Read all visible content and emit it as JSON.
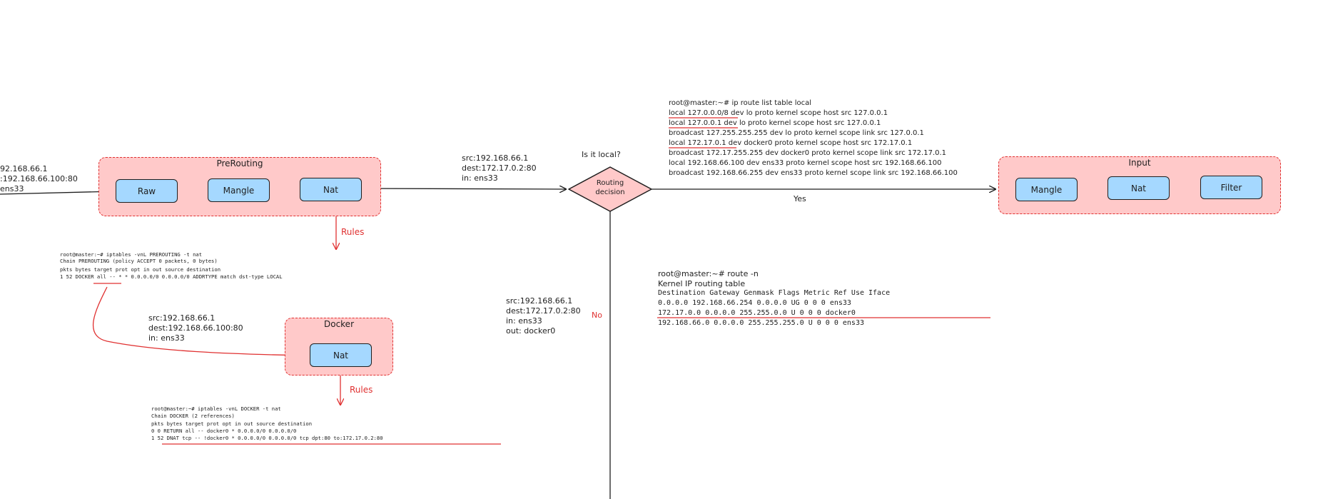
{
  "prerouting": {
    "title": "PreRouting",
    "raw": "Raw",
    "mangle": "Mangle",
    "nat": "Nat"
  },
  "input_packet": {
    "line1": "92.168.66.1",
    "line2": ":192.168.66.100:80",
    "line3": "ens33"
  },
  "rules_1": "Rules",
  "rules_2": "Rules",
  "prerouting_cmd": {
    "line1": "root@master:~# iptables -vnL PREROUTING -t nat",
    "line2": "Chain PREROUTING (policy ACCEPT 0 packets, 0 bytes)",
    "header": " pkts bytes target     prot opt in     out     source               destination",
    "row": "    1    52 DOCKER     all  --  *      *       0.0.0.0/0            0.0.0.0/0            ADDRTYPE match dst-type LOCAL"
  },
  "docker_packet": {
    "line1": "src:192.168.66.1",
    "line2": "dest:192.168.66.100:80",
    "line3": "in: ens33"
  },
  "docker": {
    "title": "Docker",
    "nat": "Nat"
  },
  "docker_cmd": {
    "line1": "root@master:~# iptables -vnL DOCKER -t nat",
    "line2": "Chain DOCKER (2 references)",
    "header": " pkts bytes target     prot opt in     out     source               destination",
    "row1": "    0     0 RETURN     all  --  docker0 *       0.0.0.0/0            0.0.0.0/0",
    "row2": "    1    52 DNAT       tcp  --  !docker0 *       0.0.0.0/0            0.0.0.0/0            tcp dpt:80 to:172.17.0.2:80"
  },
  "after_nat_packet": {
    "line1": "src:192.168.66.1",
    "line2": "dest:172.17.0.2:80",
    "line3": "in: ens33"
  },
  "decision": {
    "question": "Is it local?",
    "label": "Routing decision",
    "yes": "Yes",
    "no": "No"
  },
  "no_packet": {
    "line1": "src:192.168.66.1",
    "line2": "dest:172.17.0.2:80",
    "line3": "in: ens33",
    "line4": "out: docker0"
  },
  "ip_route": {
    "cmd": "root@master:~# ip route list table local",
    "lines": [
      "local 127.0.0.0/8 dev lo proto kernel scope host src 127.0.0.1",
      "local 127.0.0.1 dev lo proto kernel scope host src 127.0.0.1",
      "broadcast 127.255.255.255 dev lo proto kernel scope link src 127.0.0.1",
      "local 172.17.0.1 dev docker0 proto kernel scope host src 172.17.0.1",
      "broadcast 172.17.255.255 dev docker0 proto kernel scope link src 172.17.0.1",
      "local 192.168.66.100 dev ens33 proto kernel scope host src 192.168.66.100",
      "broadcast 192.168.66.255 dev ens33 proto kernel scope link src 192.168.66.100"
    ]
  },
  "route_n": {
    "cmd": "root@master:~# route -n",
    "title": "Kernel IP routing table",
    "header": "Destination     Gateway         Genmask         Flags Metric Ref    Use Iface",
    "rows": [
      "0.0.0.0         192.168.66.254  0.0.0.0         UG    0      0        0 ens33",
      "172.17.0.0      0.0.0.0         255.255.0.0     U     0      0        0 docker0",
      "192.168.66.0    0.0.0.0         255.255.255.0   U     0      0        0 ens33"
    ]
  },
  "input": {
    "title": "Input",
    "mangle": "Mangle",
    "nat": "Nat",
    "filter": "Filter"
  },
  "colors": {
    "group_fill": "#ffc9c9",
    "group_stroke": "#e03131",
    "box_fill": "#a5d8ff",
    "stroke": "#1e1e1e",
    "accent_red": "#e03131"
  }
}
